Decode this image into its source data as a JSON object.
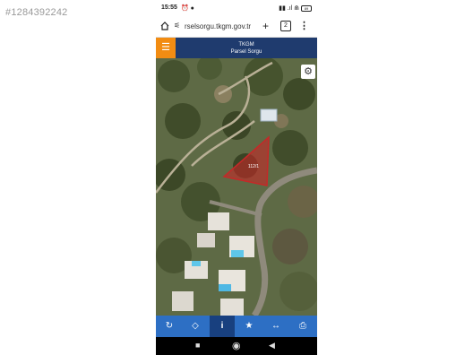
{
  "watermark": "#1284392242",
  "status_bar": {
    "time": "15:55",
    "status_icons": "⏰ ●",
    "right_icons": "▮▮ .ıl ⋒",
    "battery": "89"
  },
  "browser": {
    "url": "rselsorgu.tkgm.gov.tr",
    "home_icon": "home-icon",
    "plus_label": "+",
    "tab_count": "2",
    "menu_label": "⋮"
  },
  "app": {
    "title": "TKGM",
    "subtitle": "Parsel Sorgu",
    "menu_icon": "☰"
  },
  "map": {
    "parcel_label": "112/1",
    "parcel_color": "#c62828",
    "settings_icon": "⚙"
  },
  "toolbar": {
    "buttons": [
      {
        "name": "refresh-icon",
        "glyph": "↻"
      },
      {
        "name": "locate-icon",
        "glyph": "◇"
      },
      {
        "name": "info-icon",
        "glyph": "i"
      },
      {
        "name": "favorite-icon",
        "glyph": "★"
      },
      {
        "name": "measure-icon",
        "glyph": "↔"
      },
      {
        "name": "print-icon",
        "glyph": "⎙"
      }
    ]
  },
  "nav_bar": {
    "recent": "■",
    "home": "◉",
    "back": "◀"
  }
}
